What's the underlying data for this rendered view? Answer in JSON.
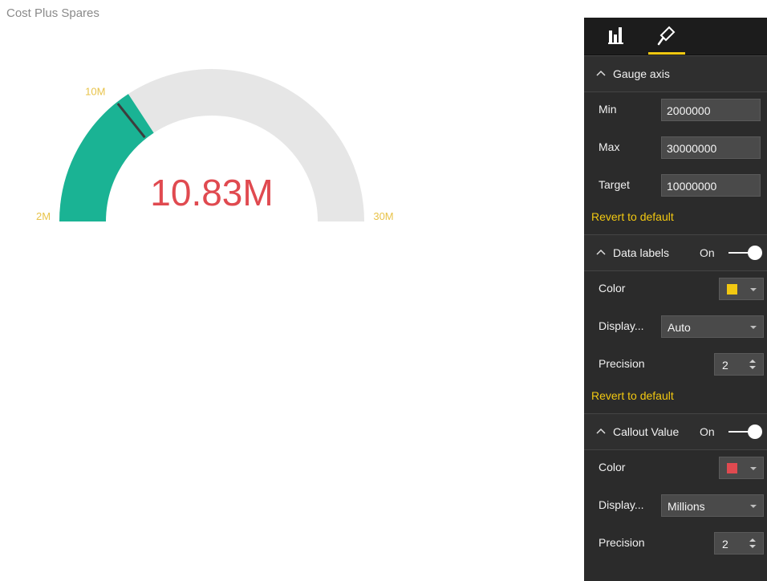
{
  "visual": {
    "title": "Cost Plus Spares",
    "callout_value": "10.83M",
    "labels": {
      "min": "2M",
      "max": "30M",
      "target": "10M"
    }
  },
  "chart_data": {
    "type": "gauge",
    "min": 2000000,
    "max": 30000000,
    "value": 10830000,
    "target": 10000000,
    "colors": {
      "fill": "#1ab394",
      "track": "#e6e6e6",
      "target_line": "#3d3d3d",
      "callout": "#e04a50",
      "labels": "#e8c34a"
    }
  },
  "pane": {
    "tabs": [
      {
        "name": "fields",
        "icon": "bar-chart-icon"
      },
      {
        "name": "format",
        "icon": "paint-roller-icon",
        "active": true
      }
    ],
    "gauge_axis": {
      "title": "Gauge axis",
      "min_label": "Min",
      "min_value": "2000000",
      "max_label": "Max",
      "max_value": "30000000",
      "target_label": "Target",
      "target_value": "10000000",
      "revert": "Revert to default"
    },
    "data_labels": {
      "title": "Data labels",
      "state": "On",
      "color_label": "Color",
      "color": "#f2c811",
      "display_label": "Display...",
      "display_value": "Auto",
      "precision_label": "Precision",
      "precision_value": "2",
      "revert": "Revert to default"
    },
    "callout_value": {
      "title": "Callout Value",
      "state": "On",
      "color_label": "Color",
      "color": "#e04a50",
      "display_label": "Display...",
      "display_value": "Millions",
      "precision_label": "Precision",
      "precision_value": "2"
    },
    "accent": "#f2c811"
  }
}
